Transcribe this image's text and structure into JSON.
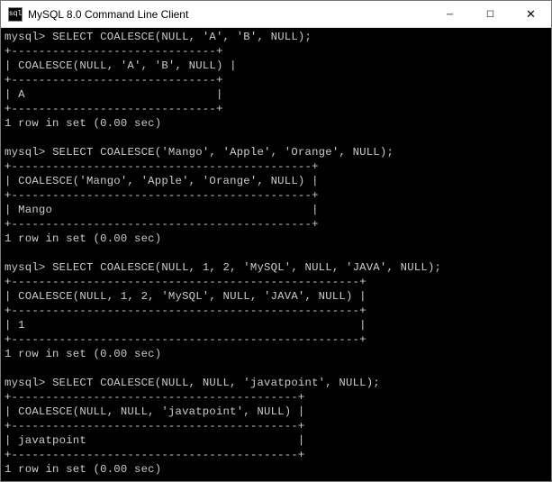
{
  "window": {
    "title": "MySQL 8.0 Command Line Client",
    "icon_label": "sql"
  },
  "controls": {
    "minimize": "─",
    "maximize": "☐",
    "close": "✕"
  },
  "terminal": {
    "prompt": "mysql>",
    "blocks": [
      {
        "query": "SELECT COALESCE(NULL, 'A', 'B', NULL);",
        "border": "+------------------------------+",
        "header": "| COALESCE(NULL, 'A', 'B', NULL) |",
        "row": "| A                            |",
        "footer": "1 row in set (0.00 sec)"
      },
      {
        "query": "SELECT COALESCE('Mango', 'Apple', 'Orange', NULL);",
        "border": "+--------------------------------------------+",
        "header": "| COALESCE('Mango', 'Apple', 'Orange', NULL) |",
        "row": "| Mango                                      |",
        "footer": "1 row in set (0.00 sec)"
      },
      {
        "query": "SELECT COALESCE(NULL, 1, 2, 'MySQL', NULL, 'JAVA', NULL);",
        "border": "+---------------------------------------------------+",
        "header": "| COALESCE(NULL, 1, 2, 'MySQL', NULL, 'JAVA', NULL) |",
        "row": "| 1                                                 |",
        "footer": "1 row in set (0.00 sec)"
      },
      {
        "query": "SELECT COALESCE(NULL, NULL, 'javatpoint', NULL);",
        "border": "+------------------------------------------+",
        "header": "| COALESCE(NULL, NULL, 'javatpoint', NULL) |",
        "row": "| javatpoint                               |",
        "footer": "1 row in set (0.00 sec)"
      }
    ]
  }
}
